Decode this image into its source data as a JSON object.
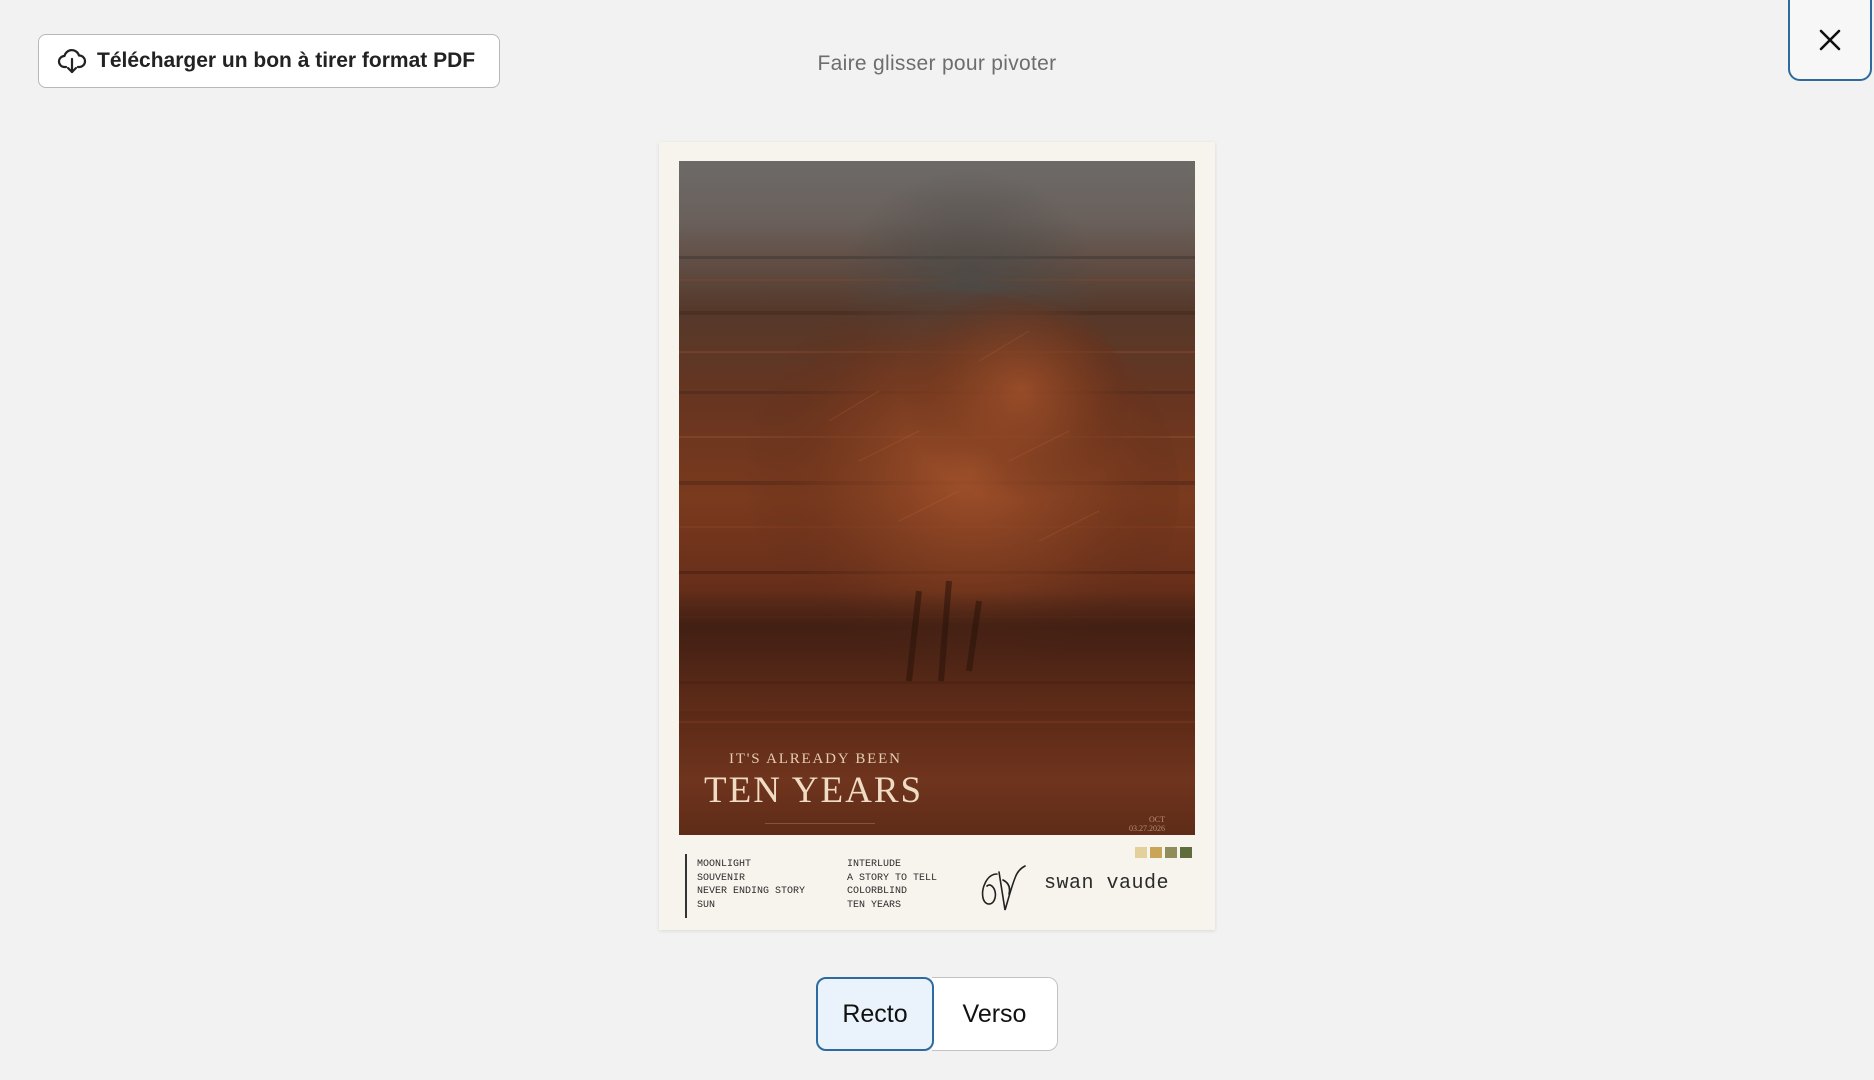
{
  "toolbar": {
    "download_label": "Télécharger un bon à tirer format PDF",
    "download_icon": "cloud-download-icon",
    "close_icon": "close-icon"
  },
  "hint": "Faire glisser pour pivoter",
  "poster": {
    "subtitle": "IT'S ALREADY BEEN",
    "title": "TEN YEARS",
    "date_line1": "OCT",
    "date_line2": "03.27.2026",
    "tracks_left": [
      "MOONLIGHT",
      "SOUVENIR",
      "NEVER ENDING STORY",
      "SUN"
    ],
    "tracks_right": [
      "INTERLUDE",
      "A STORY TO TELL",
      "COLORBLIND",
      "TEN YEARS"
    ],
    "artist": "swan vaude",
    "swatch_colors": [
      "#e3d09a",
      "#c9a657",
      "#8f8d5a",
      "#5f6c3b"
    ]
  },
  "sides": {
    "recto": "Recto",
    "verso": "Verso",
    "selected": "Recto"
  },
  "colors": {
    "accent": "#2f6a9e",
    "background": "#f2f2f2"
  }
}
